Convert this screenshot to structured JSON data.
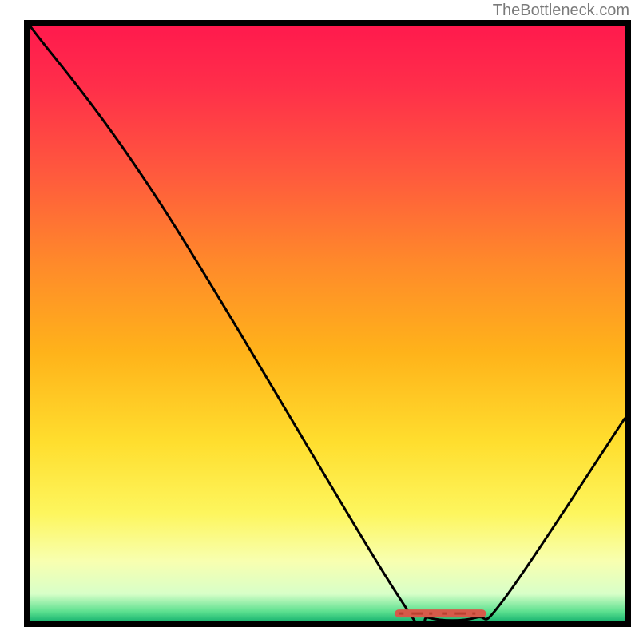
{
  "attribution": "TheBottleneck.com",
  "chart_data": {
    "type": "line",
    "title": "",
    "xlabel": "",
    "ylabel": "",
    "xlim": [
      0,
      100
    ],
    "ylim": [
      0,
      100
    ],
    "curve": [
      {
        "x": 0,
        "y": 100
      },
      {
        "x": 22,
        "y": 70
      },
      {
        "x": 62,
        "y": 4
      },
      {
        "x": 67,
        "y": 0.5
      },
      {
        "x": 75,
        "y": 0.5
      },
      {
        "x": 80,
        "y": 4
      },
      {
        "x": 100,
        "y": 34
      }
    ],
    "marker_segment": {
      "x0": 62,
      "x1": 76,
      "y": 1.2
    },
    "gradient_stops": [
      {
        "offset": 0.0,
        "color": "#ff1a4d"
      },
      {
        "offset": 0.1,
        "color": "#ff2e4a"
      },
      {
        "offset": 0.25,
        "color": "#ff5a3d"
      },
      {
        "offset": 0.4,
        "color": "#ff8a2a"
      },
      {
        "offset": 0.55,
        "color": "#ffb31a"
      },
      {
        "offset": 0.7,
        "color": "#ffde2e"
      },
      {
        "offset": 0.82,
        "color": "#fdf65e"
      },
      {
        "offset": 0.9,
        "color": "#f8ffb0"
      },
      {
        "offset": 0.955,
        "color": "#d8ffc8"
      },
      {
        "offset": 0.985,
        "color": "#5ce08f"
      },
      {
        "offset": 1.0,
        "color": "#1fb873"
      }
    ]
  }
}
